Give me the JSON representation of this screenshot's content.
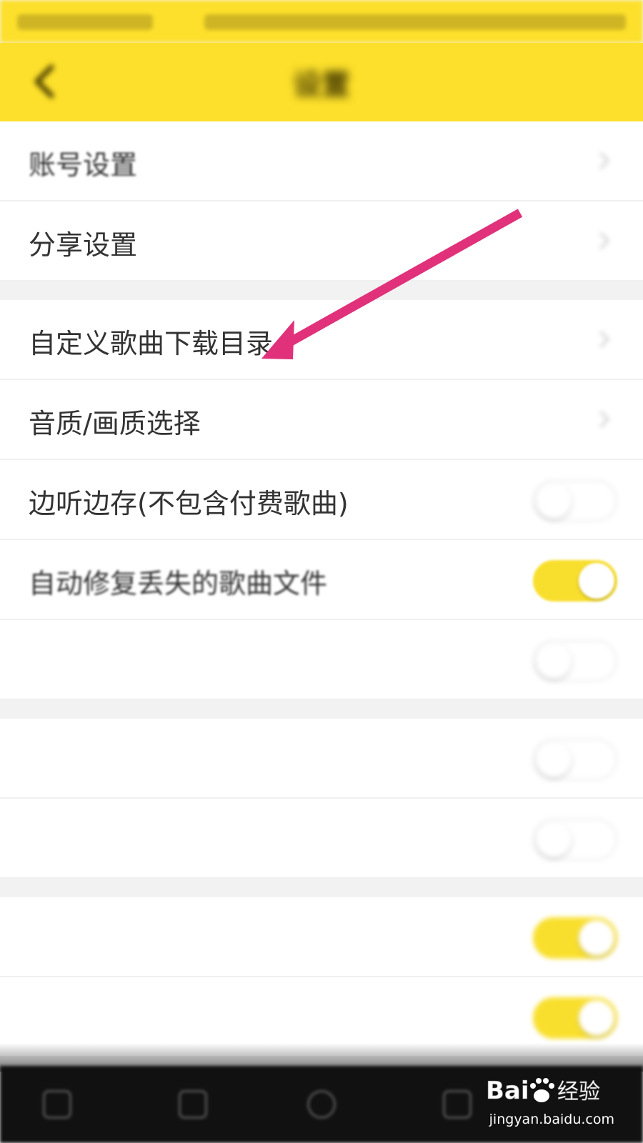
{
  "header": {
    "title": "设置"
  },
  "sections": [
    {
      "rows": [
        {
          "id": "account",
          "label": "账号设置",
          "control": "chevron"
        },
        {
          "id": "share",
          "label": "分享设置",
          "control": "chevron"
        }
      ]
    },
    {
      "rows": [
        {
          "id": "download_dir",
          "label": "自定义歌曲下载目录",
          "control": "chevron"
        },
        {
          "id": "quality",
          "label": "音质/画质选择",
          "control": "chevron"
        },
        {
          "id": "cache_while_listening",
          "label": "边听边存(不包含付费歌曲)",
          "control": "toggle",
          "on": false
        },
        {
          "id": "auto_repair",
          "label": "自动修复丢失的歌曲文件",
          "control": "toggle",
          "on": true
        },
        {
          "id": "vip_fast_download",
          "label": "",
          "control": "toggle",
          "on": false
        }
      ]
    },
    {
      "rows": [
        {
          "id": "net_play",
          "label": "",
          "control": "toggle",
          "on": false
        },
        {
          "id": "net_download",
          "label": "",
          "control": "toggle",
          "on": false
        }
      ]
    },
    {
      "rows": [
        {
          "id": "other_play",
          "label": "",
          "control": "toggle",
          "on": true
        },
        {
          "id": "other",
          "label": "",
          "control": "toggle",
          "on": true
        }
      ]
    }
  ],
  "annotation": {
    "arrow_color": "#e0317a"
  },
  "watermark": {
    "logo": "Bai百度经验",
    "url": "jingyan.baidu.com"
  },
  "colors": {
    "header_bg": "#fde02b",
    "toggle_on": "#f9df2d"
  }
}
